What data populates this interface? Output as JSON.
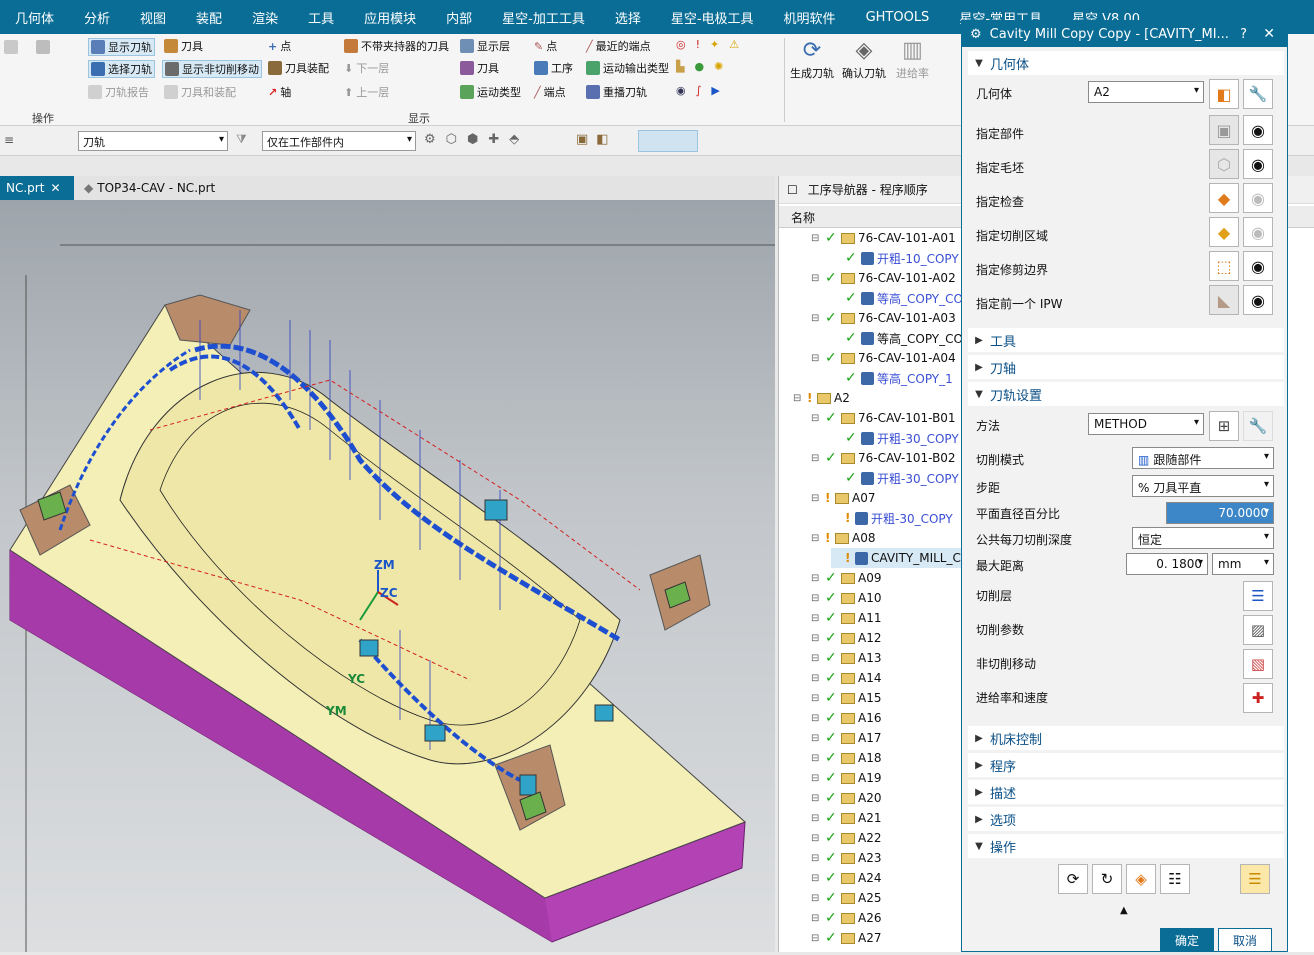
{
  "menubar": [
    "几何体",
    "分析",
    "视图",
    "装配",
    "渲染",
    "工具",
    "应用模块",
    "内部",
    "星空-加工工具",
    "选择",
    "星空-电极工具",
    "机明软件",
    "GHTOOLS",
    "星空-常用工具",
    "星空 V8.00"
  ],
  "ribbon": {
    "group_operation": "操作",
    "group_display": "显示",
    "btn_show_path": "显示刀轨",
    "btn_select_path": "选择刀轨",
    "btn_path_report": "刀轨报告",
    "btn_tool": "刀具",
    "btn_show_noncut": "显示非切削移动",
    "btn_tool_holder": "刀具和装配",
    "btn_point": "点",
    "btn_tool_assembly": "刀具装配",
    "btn_axis": "轴",
    "btn_no_holder": "不带夹持器的刀具",
    "btn_next_layer": "下一层",
    "btn_prev_layer": "上一层",
    "btn_show_layer": "显示层",
    "btn_tool2": "刀具",
    "btn_motion_type": "运动类型",
    "btn_point2": "点",
    "btn_op_order": "工序",
    "btn_endpoint": "端点",
    "btn_nearest_endpoint": "最近的端点",
    "btn_motion_output": "运动输出类型",
    "btn_replay": "重播刀轨",
    "btn_generate": "生成刀轨",
    "btn_confirm": "确认刀轨",
    "btn_feed": "进给率"
  },
  "toolbar2": {
    "filter_value": "刀轨",
    "scope_value": "仅在工作部件内"
  },
  "tabs": {
    "tab1": "NC.prt",
    "tab2": "TOP34-CAV - NC.prt"
  },
  "viewport": {
    "labels": {
      "zm": "ZM",
      "zc": "ZC",
      "yc": "YC",
      "ym": "YM"
    }
  },
  "navigator": {
    "title": "工序导航器 - 程序顺序",
    "column_name": "名称",
    "rows": [
      {
        "text": "76-CAV-101-A01",
        "status": "ok",
        "type": "group",
        "indent": 0
      },
      {
        "text": "开粗-10_COPY",
        "status": "ok",
        "type": "op",
        "indent": 1,
        "blue": true
      },
      {
        "text": "76-CAV-101-A02",
        "status": "ok",
        "type": "group",
        "indent": 0
      },
      {
        "text": "等高_COPY_CO",
        "status": "ok",
        "type": "op",
        "indent": 1,
        "blue": true
      },
      {
        "text": "76-CAV-101-A03",
        "status": "ok",
        "type": "group",
        "indent": 0
      },
      {
        "text": "等高_COPY_CO",
        "status": "ok",
        "type": "op",
        "indent": 1,
        "blue": false
      },
      {
        "text": "76-CAV-101-A04",
        "status": "ok",
        "type": "group",
        "indent": 0
      },
      {
        "text": "等高_COPY_1",
        "status": "ok",
        "type": "op",
        "indent": 1,
        "blue": true
      },
      {
        "text": "A2",
        "status": "warn",
        "type": "group",
        "indent": -1
      },
      {
        "text": "76-CAV-101-B01",
        "status": "ok",
        "type": "group",
        "indent": 0
      },
      {
        "text": "开粗-30_COPY",
        "status": "ok",
        "type": "op",
        "indent": 1,
        "blue": true
      },
      {
        "text": "76-CAV-101-B02",
        "status": "ok",
        "type": "group",
        "indent": 0
      },
      {
        "text": "开粗-30_COPY",
        "status": "ok",
        "type": "op",
        "indent": 1,
        "blue": true
      },
      {
        "text": "A07",
        "status": "warn",
        "type": "group",
        "indent": 0
      },
      {
        "text": "开粗-30_COPY",
        "status": "warn",
        "type": "op",
        "indent": 1,
        "blue": true
      },
      {
        "text": "A08",
        "status": "warn",
        "type": "group",
        "indent": 0
      },
      {
        "text": "CAVITY_MILL_C",
        "status": "warn",
        "type": "op",
        "indent": 1,
        "blue": false,
        "selected": true
      },
      {
        "text": "A09",
        "status": "ok",
        "type": "group",
        "indent": 0
      },
      {
        "text": "A10",
        "status": "ok",
        "type": "group",
        "indent": 0
      },
      {
        "text": "A11",
        "status": "ok",
        "type": "group",
        "indent": 0
      },
      {
        "text": "A12",
        "status": "ok",
        "type": "group",
        "indent": 0
      },
      {
        "text": "A13",
        "status": "ok",
        "type": "group",
        "indent": 0
      },
      {
        "text": "A14",
        "status": "ok",
        "type": "group",
        "indent": 0
      },
      {
        "text": "A15",
        "status": "ok",
        "type": "group",
        "indent": 0
      },
      {
        "text": "A16",
        "status": "ok",
        "type": "group",
        "indent": 0
      },
      {
        "text": "A17",
        "status": "ok",
        "type": "group",
        "indent": 0
      },
      {
        "text": "A18",
        "status": "ok",
        "type": "group",
        "indent": 0
      },
      {
        "text": "A19",
        "status": "ok",
        "type": "group",
        "indent": 0
      },
      {
        "text": "A20",
        "status": "ok",
        "type": "group",
        "indent": 0
      },
      {
        "text": "A21",
        "status": "ok",
        "type": "group",
        "indent": 0
      },
      {
        "text": "A22",
        "status": "ok",
        "type": "group",
        "indent": 0
      },
      {
        "text": "A23",
        "status": "ok",
        "type": "group",
        "indent": 0
      },
      {
        "text": "A24",
        "status": "ok",
        "type": "group",
        "indent": 0
      },
      {
        "text": "A25",
        "status": "ok",
        "type": "group",
        "indent": 0
      },
      {
        "text": "A26",
        "status": "ok",
        "type": "group",
        "indent": 0
      },
      {
        "text": "A27",
        "status": "ok",
        "type": "group",
        "indent": 0
      }
    ]
  },
  "dialog": {
    "title": "Cavity Mill Copy Copy - [CAVITY_MI...",
    "help": "?",
    "close": "✕",
    "sec_geometry": "几何体",
    "geometry_label": "几何体",
    "geometry_value": "A2",
    "specify_part": "指定部件",
    "specify_blank": "指定毛坯",
    "specify_check": "指定检查",
    "specify_cut_area": "指定切削区域",
    "specify_trim": "指定修剪边界",
    "specify_prev_ipw": "指定前一个 IPW",
    "sec_tool": "工具",
    "sec_axis": "刀轴",
    "sec_path_settings": "刀轨设置",
    "method_label": "方法",
    "method_value": "METHOD",
    "cut_pattern_label": "切削模式",
    "cut_pattern_value": "跟随部件",
    "stepover_label": "步距",
    "stepover_value": "% 刀具平直",
    "flat_percent_label": "平面直径百分比",
    "flat_percent_value": "70.0000",
    "depth_per_cut_label": "公共每刀切削深度",
    "depth_per_cut_value": "恒定",
    "max_distance_label": "最大距离",
    "max_distance_value": "0. 1800",
    "max_distance_unit": "mm",
    "cut_levels": "切削层",
    "cut_params": "切削参数",
    "noncut_moves": "非切削移动",
    "feeds_speeds": "进给率和速度",
    "sec_machine": "机床控制",
    "sec_program": "程序",
    "sec_description": "描述",
    "sec_options": "选项",
    "sec_actions": "操作",
    "ok": "确定",
    "cancel": "取消"
  },
  "colors": {
    "brand": "#0a6d96",
    "ok": "#16a316",
    "warn": "#e08a00",
    "part": "#f3efb7",
    "base": "#b343b5"
  }
}
